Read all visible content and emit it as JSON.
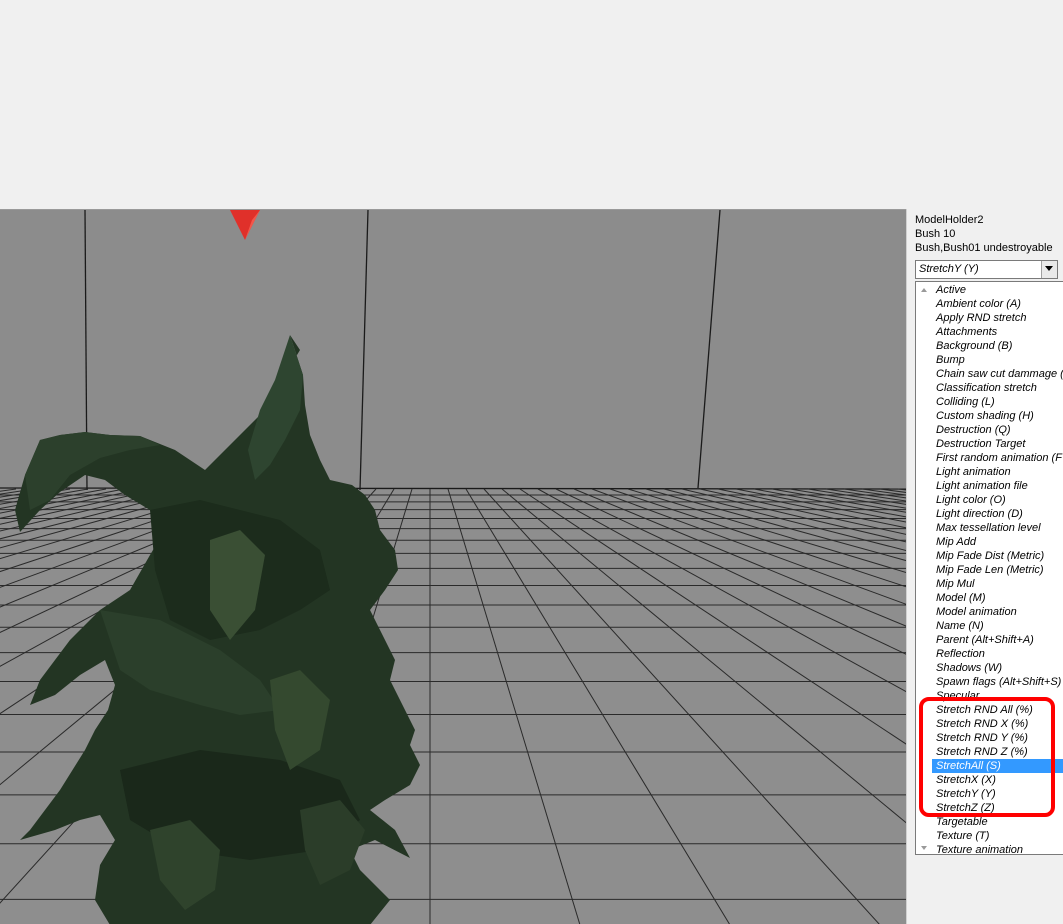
{
  "panel": {
    "line1": "ModelHolder2",
    "line2": "Bush 10",
    "line3": "Bush,Bush01 undestroyable",
    "combo_value": "StretchY (Y)",
    "selected_index": 34,
    "highlight_range": [
      30,
      37
    ]
  },
  "properties": [
    "Active",
    "Ambient color (A)",
    "Apply RND stretch",
    "Attachments",
    "Background (B)",
    "Bump",
    "Chain saw cut dammage (",
    "Classification stretch",
    "Colliding (L)",
    "Custom shading (H)",
    "Destruction (Q)",
    "Destruction Target",
    "First random animation (F",
    "Light animation",
    "Light animation file",
    "Light color (O)",
    "Light direction (D)",
    "Max tessellation level",
    "Mip Add",
    "Mip Fade Dist (Metric)",
    "Mip Fade Len (Metric)",
    "Mip Mul",
    "Model (M)",
    "Model animation",
    "Name (N)",
    "Parent (Alt+Shift+A)",
    "Reflection",
    "Shadows (W)",
    "Spawn flags (Alt+Shift+S)",
    "Specular",
    "Stretch RND All (%)",
    "Stretch RND X (%)",
    "Stretch RND Y (%)",
    "Stretch RND Z (%)",
    "StretchAll (S)",
    "StretchX (X)",
    "StretchY (Y)",
    "StretchZ (Z)",
    "Targetable",
    "Texture (T)",
    "Texture animation"
  ],
  "colors": {
    "viewport_bg": "#8a8a8a",
    "selection": "#3399ff",
    "highlight": "#ff0000",
    "foliage": "#233523"
  }
}
